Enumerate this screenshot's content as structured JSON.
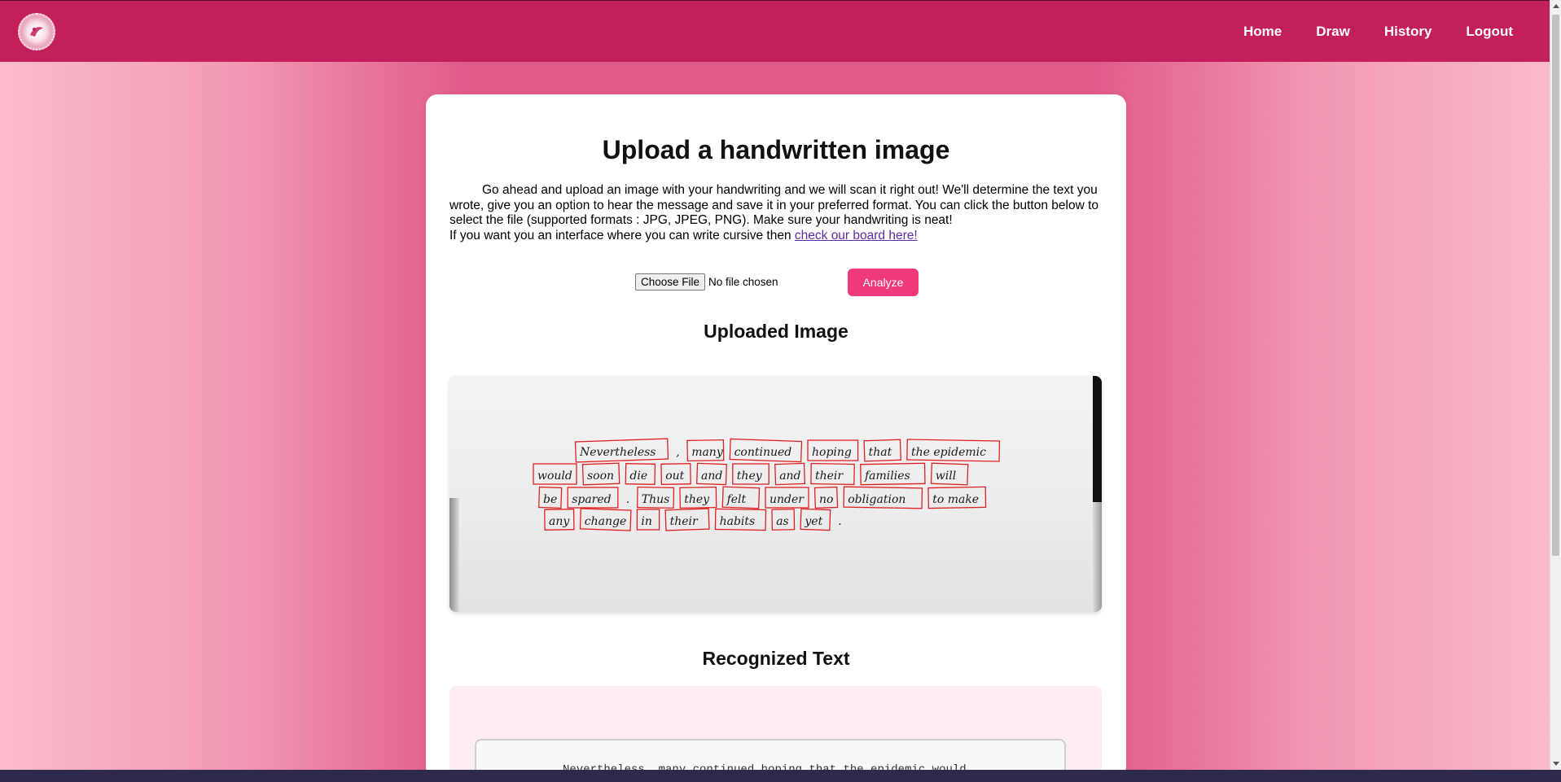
{
  "nav": {
    "links": [
      "Home",
      "Draw",
      "History",
      "Logout"
    ]
  },
  "main": {
    "title": "Upload a handwritten image",
    "intro_text": "Go ahead and upload an image with your handwriting and we will scan it right out! We'll determine the text you wrote, give you an option to hear the message and save it in your preferred format. You can click the button below to select the file (supported formats : JPG, JPEG, PNG). Make sure your handwriting is neat!",
    "board_prefix": "If you want you an interface where you can write cursive then ",
    "board_link": "check our board here!"
  },
  "upload": {
    "choose_label": "Choose File",
    "file_status": "No file chosen",
    "analyze_label": "Analyze"
  },
  "uploaded": {
    "title": "Uploaded Image",
    "words": [
      [
        "Nevertheless",
        ",",
        "many",
        "continued",
        "hoping",
        "that",
        "the epidemic"
      ],
      [
        "would",
        "soon",
        "die",
        "out",
        "and",
        "they",
        "and",
        "their",
        "families",
        "will"
      ],
      [
        "be",
        "spared",
        ".",
        "Thus",
        "they",
        "felt",
        "under",
        "no",
        "obligation",
        "to make"
      ],
      [
        "any",
        "change",
        "in",
        "their",
        "habits",
        "as",
        "yet",
        "."
      ]
    ]
  },
  "recognized": {
    "title": "Recognized Text",
    "text": "Nevertheless, many continued hoping that the epidemic would"
  },
  "colors": {
    "nav_bg": "#c21f5c",
    "accent_button": "#f0397c",
    "link": "#5b2aa6",
    "box_stroke": "#e02020"
  }
}
